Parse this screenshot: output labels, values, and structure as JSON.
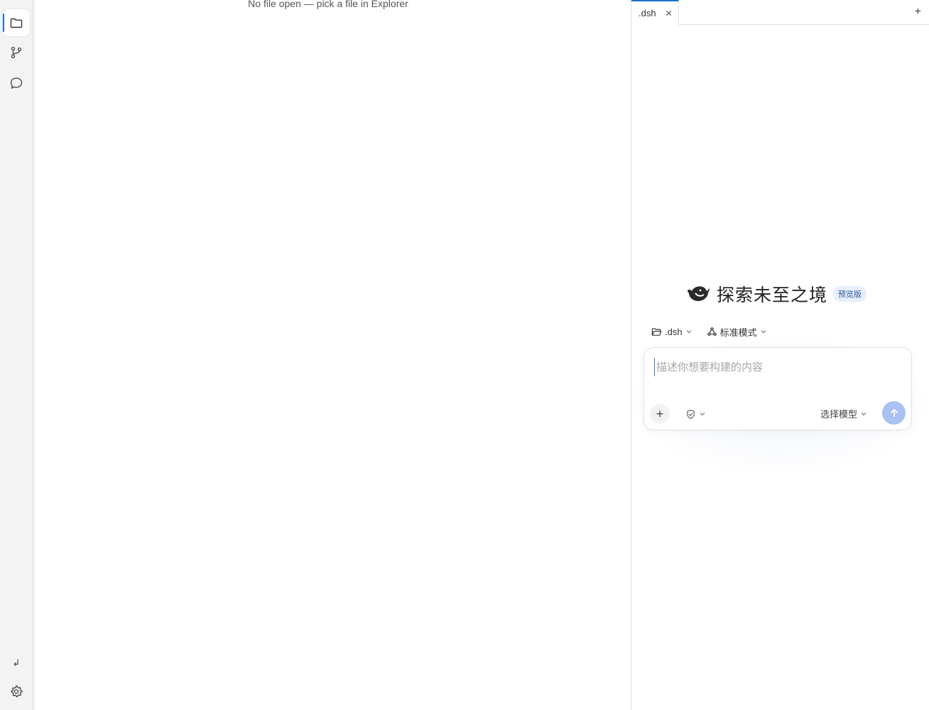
{
  "activity_bar": {
    "items": [
      {
        "name": "explorer",
        "icon": "folder-icon",
        "active": true
      },
      {
        "name": "source-control",
        "icon": "git-branch-icon",
        "active": false
      },
      {
        "name": "chat",
        "icon": "chat-bubble-icon",
        "active": false
      }
    ],
    "return_icon": "return-arrow-icon",
    "settings_icon": "gear-icon"
  },
  "editor": {
    "empty_message": "No file open — pick a file in Explorer"
  },
  "right_panel": {
    "tabs": [
      {
        "label": ".dsh",
        "active": true,
        "close_glyph": "✕"
      }
    ],
    "add_tab_glyph": "+",
    "hero": {
      "logo_icon": "whale-logo-icon",
      "title": "探索未至之境",
      "badge": "预览版"
    },
    "selectors": {
      "folder": {
        "icon": "folder-open-icon",
        "label": ".dsh"
      },
      "mode": {
        "icon": "mode-cycle-icon",
        "label": "标准模式"
      }
    },
    "composer": {
      "placeholder": "描述你想要构建的内容",
      "value": "",
      "add_glyph": "+",
      "tool_icon": "shield-tool-icon",
      "model_label": "选择模型",
      "send_icon": "arrow-up-icon"
    }
  },
  "colors": {
    "accent": "#1a73c8",
    "badge_bg": "#e6effb",
    "send_button": "#a9c1f3",
    "activity_bg": "#f3f3f3"
  }
}
